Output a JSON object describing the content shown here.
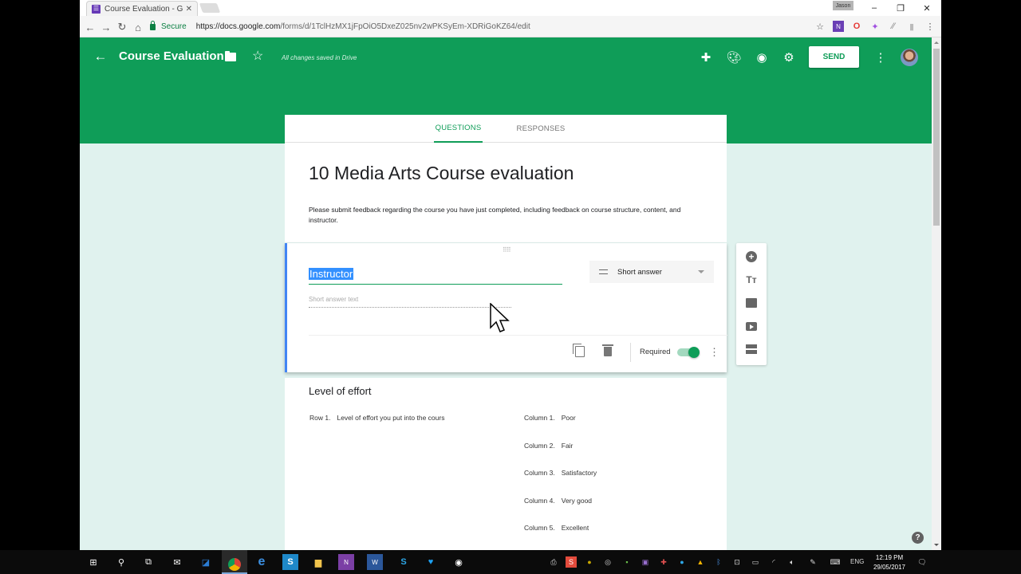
{
  "browser": {
    "tab_title": "Course Evaluation - Goo",
    "profile_name": "Jason",
    "secure_label": "Secure",
    "url_host": "https://docs.google.com",
    "url_path": "/forms/d/1TclHzMX1jFpOiO5DxeZ025nv2wPKSyEm-XDRiGoKZ64/edit"
  },
  "header": {
    "title": "Course Evaluation",
    "saved_status": "All changes saved in Drive",
    "send_label": "SEND",
    "icons": [
      "addon-icon",
      "palette-icon",
      "preview-eye-icon",
      "settings-gear-icon"
    ],
    "brand_color": "#0f9d58"
  },
  "form_tabs": [
    {
      "label": "QUESTIONS",
      "active": true
    },
    {
      "label": "RESPONSES",
      "active": false
    }
  ],
  "form": {
    "title": "10 Media Arts Course evaluation",
    "description": "Please submit feedback regarding the course you have just completed, including feedback on course structure, content, and instructor."
  },
  "active_question": {
    "title": "Instructor",
    "type": "Short answer",
    "answer_placeholder": "Short answer text",
    "required_label": "Required",
    "required": true
  },
  "grid_question": {
    "title": "Level of effort",
    "rows": [
      {
        "num": "Row 1.",
        "label": "Level of effort you put into the cours"
      }
    ],
    "columns": [
      {
        "num": "Column 1.",
        "label": "Poor"
      },
      {
        "num": "Column 2.",
        "label": "Fair"
      },
      {
        "num": "Column 3.",
        "label": "Satisfactory"
      },
      {
        "num": "Column 4.",
        "label": "Very good"
      },
      {
        "num": "Column 5.",
        "label": "Excellent"
      }
    ]
  },
  "side_toolbar": [
    "add-question-icon",
    "add-title-icon",
    "add-image-icon",
    "add-video-icon",
    "add-section-icon"
  ],
  "taskbar": {
    "time": "12:19 PM",
    "date": "29/05/2017",
    "lang": "ENG"
  }
}
